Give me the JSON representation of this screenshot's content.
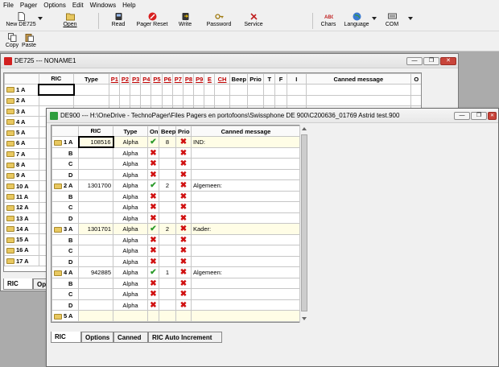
{
  "menu": [
    "File",
    "Pager",
    "Options",
    "Edit",
    "Windows",
    "Help"
  ],
  "toolbar": {
    "new_label": "New DE725",
    "open_label": "Open",
    "read_label": "Read",
    "pager_reset_label": "Pager Reset",
    "write_label": "Write",
    "password_label": "Password",
    "service_label": "Service",
    "chars_label": "Chars",
    "language_label": "Language",
    "com_label": "COM"
  },
  "toolbar2": {
    "copy_label": "Copy",
    "paste_label": "Paste"
  },
  "win1": {
    "title": "DE725 --- NONAME1",
    "headers": [
      "RIC",
      "Type",
      "P1",
      "P2",
      "P3",
      "P4",
      "P5",
      "P6",
      "P7",
      "P8",
      "P9",
      "E",
      "CH",
      "Beep",
      "Prio",
      "T",
      "F",
      "I",
      "Canned message",
      "O"
    ],
    "rows": [
      "1 A",
      "2 A",
      "3 A",
      "4 A",
      "5 A",
      "6 A",
      "7 A",
      "8 A",
      "9 A",
      "10 A",
      "11 A",
      "12 A",
      "13 A",
      "14 A",
      "15 A",
      "16 A",
      "17 A"
    ],
    "tab_ric": "RIC",
    "tab_options": "Op"
  },
  "win2": {
    "title": "DE900 --- H:\\OneDrive - TechnoPager\\Files Pagers en portofoons\\Swissphone DE 900\\C200636_01769 Astrid test.900",
    "headers": [
      "RIC",
      "Type",
      "On",
      "Beep",
      "Prio",
      "Canned message"
    ],
    "rows": [
      {
        "label": "1 A",
        "folder": true,
        "ric": "108516",
        "type": "Alpha",
        "on": "check",
        "beep": "8",
        "prio": "x",
        "msg": "IND:",
        "hl": true
      },
      {
        "label": "B",
        "folder": false,
        "ric": "",
        "type": "Alpha",
        "on": "x",
        "beep": "",
        "prio": "x",
        "msg": "",
        "hl": false
      },
      {
        "label": "C",
        "folder": false,
        "ric": "",
        "type": "Alpha",
        "on": "x",
        "beep": "",
        "prio": "x",
        "msg": "",
        "hl": false
      },
      {
        "label": "D",
        "folder": false,
        "ric": "",
        "type": "Alpha",
        "on": "x",
        "beep": "",
        "prio": "x",
        "msg": "",
        "hl": false
      },
      {
        "label": "2 A",
        "folder": true,
        "ric": "1301700",
        "type": "Alpha",
        "on": "check",
        "beep": "2",
        "prio": "x",
        "msg": "Algemeen:",
        "hl": false
      },
      {
        "label": "B",
        "folder": false,
        "ric": "",
        "type": "Alpha",
        "on": "x",
        "beep": "",
        "prio": "x",
        "msg": "",
        "hl": false
      },
      {
        "label": "C",
        "folder": false,
        "ric": "",
        "type": "Alpha",
        "on": "x",
        "beep": "",
        "prio": "x",
        "msg": "",
        "hl": false
      },
      {
        "label": "D",
        "folder": false,
        "ric": "",
        "type": "Alpha",
        "on": "x",
        "beep": "",
        "prio": "x",
        "msg": "",
        "hl": false
      },
      {
        "label": "3 A",
        "folder": true,
        "ric": "1301701",
        "type": "Alpha",
        "on": "check",
        "beep": "2",
        "prio": "x",
        "msg": "Kader:",
        "hl": true
      },
      {
        "label": "B",
        "folder": false,
        "ric": "",
        "type": "Alpha",
        "on": "x",
        "beep": "",
        "prio": "x",
        "msg": "",
        "hl": false
      },
      {
        "label": "C",
        "folder": false,
        "ric": "",
        "type": "Alpha",
        "on": "x",
        "beep": "",
        "prio": "x",
        "msg": "",
        "hl": false
      },
      {
        "label": "D",
        "folder": false,
        "ric": "",
        "type": "Alpha",
        "on": "x",
        "beep": "",
        "prio": "x",
        "msg": "",
        "hl": false
      },
      {
        "label": "4 A",
        "folder": true,
        "ric": "942885",
        "type": "Alpha",
        "on": "check",
        "beep": "1",
        "prio": "x",
        "msg": "Algemeen:",
        "hl": false
      },
      {
        "label": "B",
        "folder": false,
        "ric": "",
        "type": "Alpha",
        "on": "x",
        "beep": "",
        "prio": "x",
        "msg": "",
        "hl": false
      },
      {
        "label": "C",
        "folder": false,
        "ric": "",
        "type": "Alpha",
        "on": "x",
        "beep": "",
        "prio": "x",
        "msg": "",
        "hl": false
      },
      {
        "label": "D",
        "folder": false,
        "ric": "",
        "type": "Alpha",
        "on": "x",
        "beep": "",
        "prio": "x",
        "msg": "",
        "hl": false
      },
      {
        "label": "5 A",
        "folder": true,
        "ric": "",
        "type": "",
        "on": "",
        "beep": "",
        "prio": "",
        "msg": "",
        "hl": true
      }
    ],
    "tabs": [
      "RIC",
      "Options",
      "Canned",
      "RIC Auto Increment"
    ]
  },
  "colors": {
    "check": "#2a9a2a",
    "cross": "#d01010",
    "row_highlight": "#fffde6",
    "title_icon_red": "#d22020",
    "title_icon_green": "#2e9e3e"
  }
}
